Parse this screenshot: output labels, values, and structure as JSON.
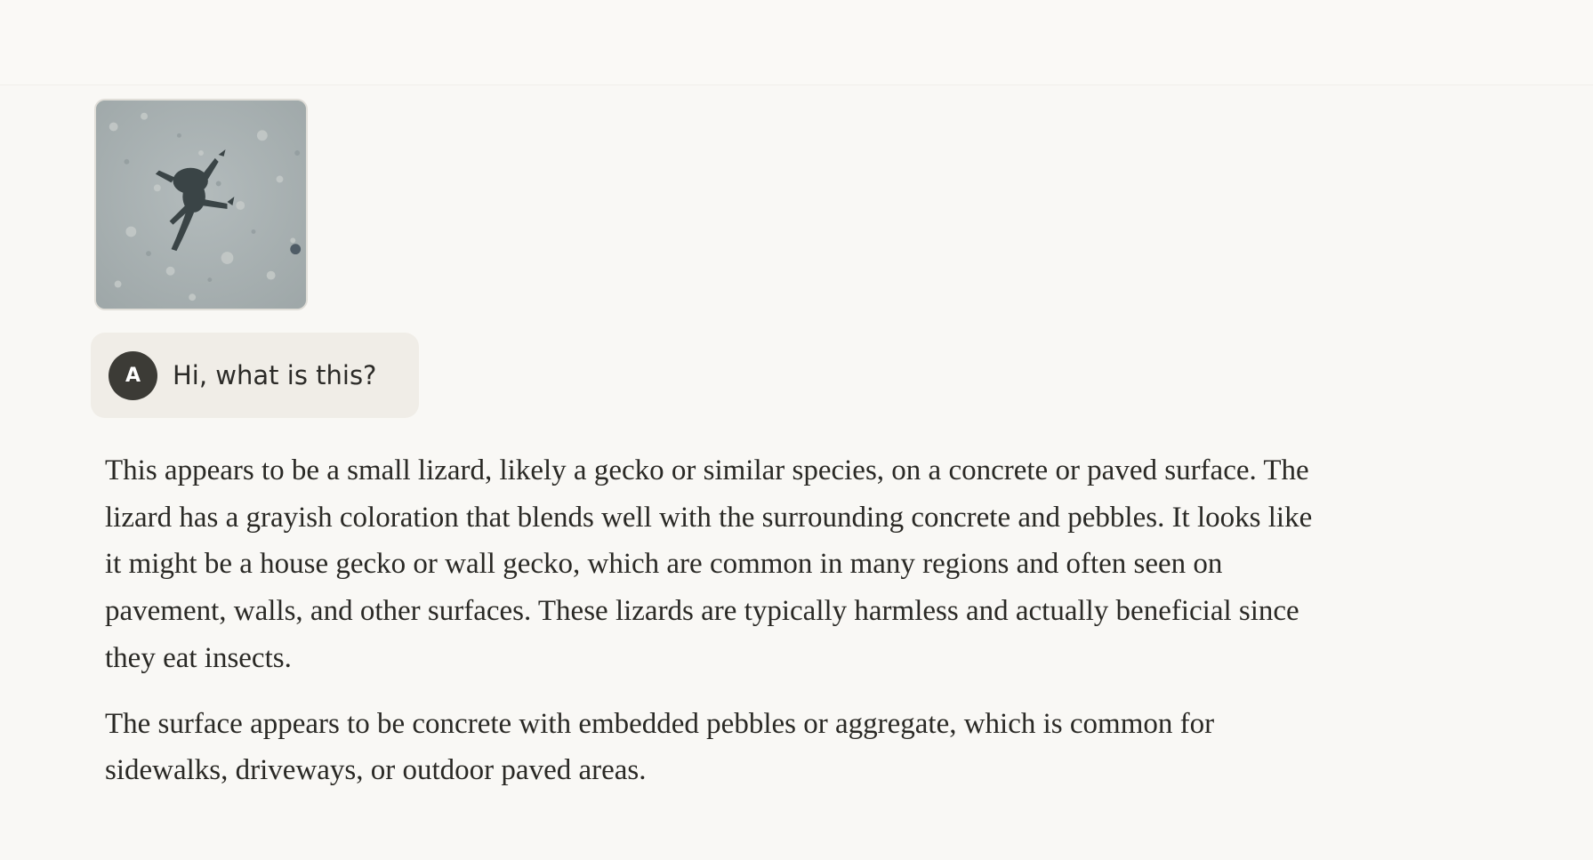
{
  "conversation": {
    "attachment": {
      "icon": "lizard-photo",
      "colors": {
        "gravel": "#a9b2b3",
        "animal": "#3a4446"
      }
    },
    "user_message": {
      "avatar_initial": "A",
      "text": "Hi, what is this?"
    },
    "assistant_message": {
      "paragraphs": [
        "This appears to be a small lizard, likely a gecko or similar species, on a concrete or paved surface. The lizard has a grayish coloration that blends well with the surrounding concrete and pebbles. It looks like it might be a house gecko or wall gecko, which are common in many regions and often seen on pavement, walls, and other surfaces. These lizards are typically harmless and actually beneficial since they eat insects.",
        "The surface appears to be concrete with embedded pebbles or aggregate, which is common for sidewalks, driveways, or outdoor paved areas."
      ]
    }
  }
}
